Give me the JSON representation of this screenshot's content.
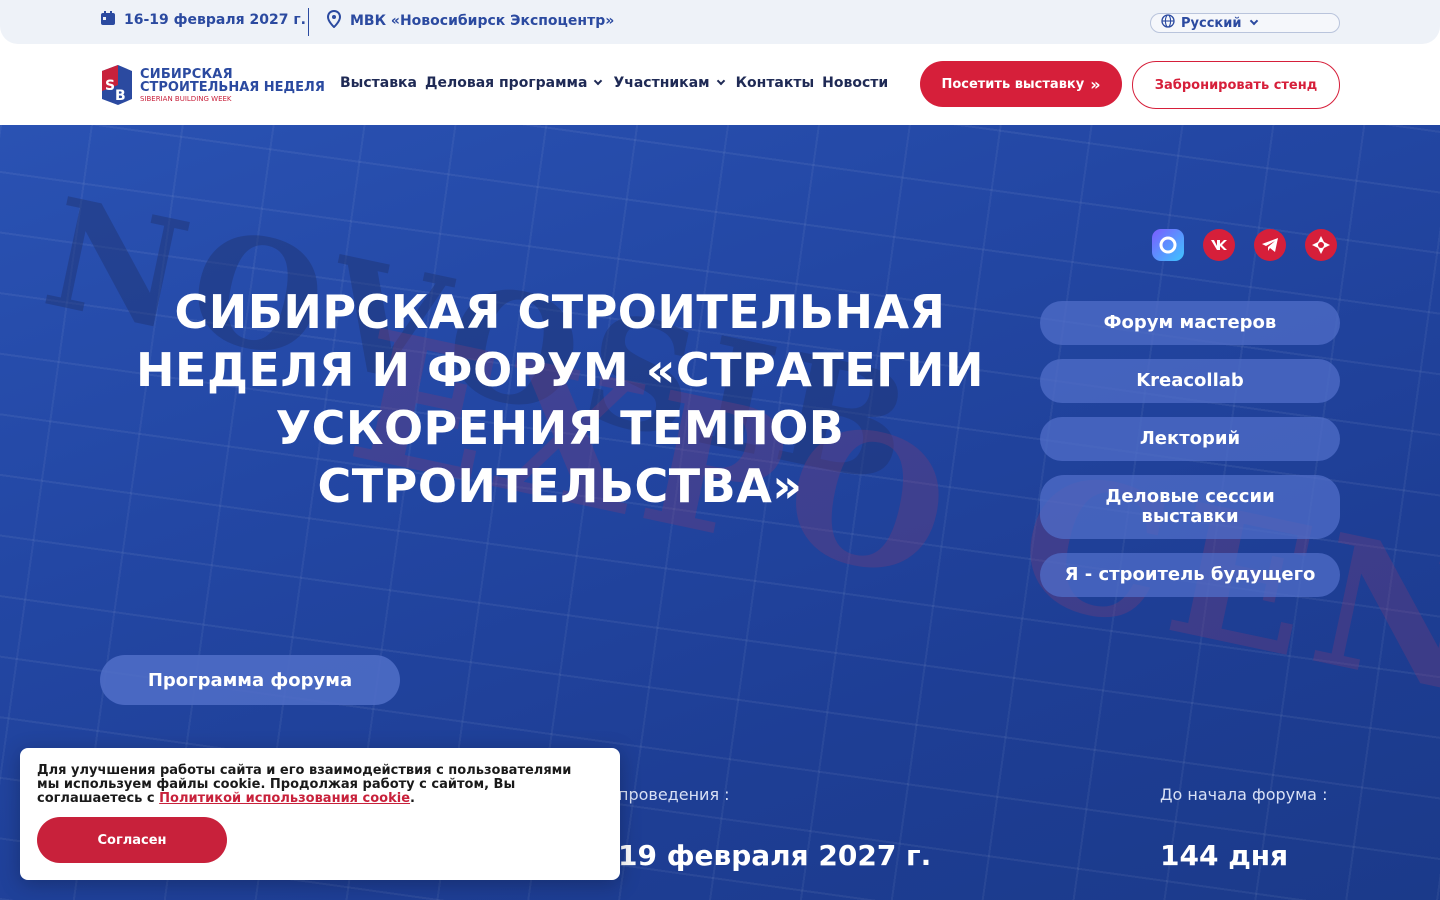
{
  "topbar": {
    "date": "16-19 февраля 2027 г.",
    "venue": "МВК «Новосибирск Экспоцентр»",
    "language": "Русский",
    "icons": {
      "date": "calendar-icon",
      "venue": "map-pin-icon",
      "language": "globe-icon"
    }
  },
  "logo": {
    "line1": "СИБИРСКАЯ",
    "line2": "СТРОИТЕЛЬНАЯ НЕДЕЛЯ",
    "line3": "SIBERIAN BUILDING WEEK"
  },
  "nav": {
    "items": [
      "Выставка",
      "Деловая программа",
      "Участникам",
      "Контакты",
      "Новости"
    ],
    "visit_button": "Посетить выставку",
    "visit_arrow": "»",
    "book_button": "Забронировать стенд"
  },
  "hero": {
    "title": "СИБИРСКАЯ СТРОИТЕЛЬНАЯ НЕДЕЛЯ И ФОРУМ «СТРАТЕГИИ УСКОРЕНИЯ ТЕМПОВ СТРОИТЕЛЬСТВА»",
    "ghost_text_1": "NOVOSIB",
    "ghost_text_2": "EXPO CENTRE",
    "side_links": [
      "Форум мастеров",
      "Kreacollab",
      "Лекторий",
      "Деловые сессии выставки",
      "Я - строитель будущего"
    ],
    "program_button": "Программа форума",
    "dates_label": "проведения :",
    "dates_value": "19 февраля 2027 г.",
    "countdown_label": "До начала форума :",
    "countdown_value": "144 дня",
    "socials": {
      "max": "max-icon",
      "vk": "vk-icon",
      "telegram": "telegram-icon",
      "rutube": "rutube-icon"
    }
  },
  "cookie": {
    "text_before": "Для улучшения работы сайта и его взаимодействия с пользователями мы используем файлы cookie. Продолжая работу с сайтом, Вы соглашаетесь с ",
    "link": "Политикой использования cookie",
    "text_after": ".",
    "button": "Согласен"
  },
  "colors": {
    "brand_blue": "#2b4aa0",
    "brand_red": "#d61f3a",
    "hero_bg": "#2347a4"
  }
}
